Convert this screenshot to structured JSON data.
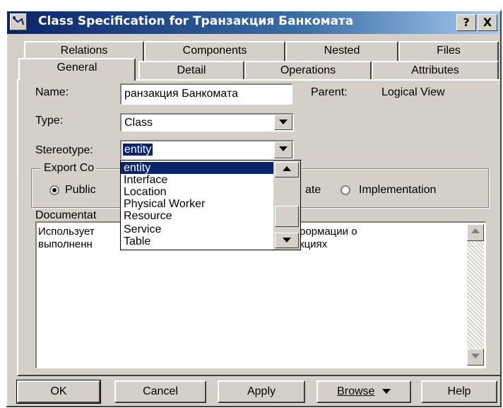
{
  "window": {
    "title": "Class Specification for Транзакция Банкомата",
    "help_btn": "?",
    "close_btn": "X"
  },
  "tabs_back": [
    "Relations",
    "Components",
    "Nested",
    "Files"
  ],
  "tabs_front": [
    "General",
    "Detail",
    "Operations",
    "Attributes"
  ],
  "form": {
    "name_label": "Name:",
    "name_value": "ранзакция Банкомата",
    "parent_label": "Parent:",
    "parent_value": "Logical View",
    "type_label": "Type:",
    "type_value": "Class",
    "stereotype_label": "Stereotype:",
    "stereotype_value": "entity",
    "export_label": "Export Co",
    "export_options": [
      "Public",
      "ate",
      "Implementation"
    ],
    "export_selected": "Public",
    "doc_label": "Documentat",
    "doc_line1": "Использует",
    "doc_line1_tail": "рормации о",
    "doc_line2": "выполненн",
    "doc_line2_tail": "кциях"
  },
  "stereotype_list": {
    "items": [
      "entity",
      "Interface",
      "Location",
      "Physical Worker",
      "Resource",
      "Service",
      "Table"
    ],
    "selected": "entity"
  },
  "buttons": {
    "ok": "OK",
    "cancel": "Cancel",
    "apply": "Apply",
    "browse": "Browse",
    "help": "Help"
  },
  "colors": {
    "titlebar": "#0a246a",
    "face": "#d4d0c8",
    "selection": "#0a246a"
  }
}
